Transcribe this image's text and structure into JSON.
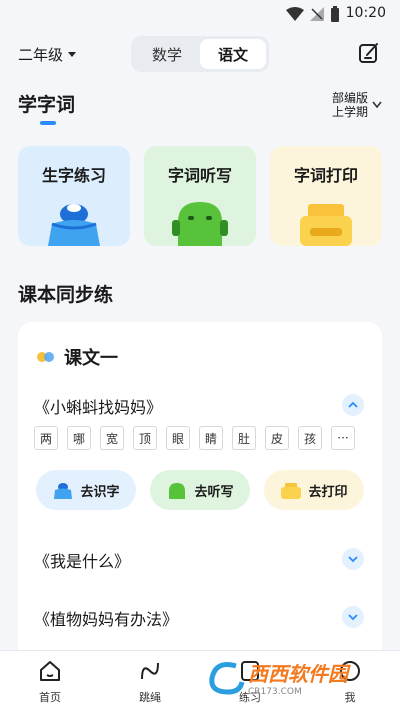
{
  "status_bar": {
    "time": "10:20"
  },
  "header": {
    "grade": "二年级",
    "subjects": [
      "数学",
      "语文"
    ],
    "active_subject": "语文"
  },
  "learn_section": {
    "title": "学字词",
    "edition_line1": "部编版",
    "edition_line2": "上学期",
    "cards": [
      {
        "label": "生字练习",
        "bg": "#dceefd",
        "icon": "hat-icon"
      },
      {
        "label": "字词听写",
        "bg": "#dff4df",
        "icon": "headphone-icon"
      },
      {
        "label": "字词打印",
        "bg": "#fdf4dc",
        "icon": "printer-icon"
      }
    ]
  },
  "sync_section": {
    "title": "课本同步练",
    "lesson_title": "课文一",
    "texts": [
      "《小蝌蚪找妈妈》",
      "《我是什么》",
      "《植物妈妈有办法》"
    ],
    "characters": [
      "两",
      "哪",
      "宽",
      "顶",
      "眼",
      "睛",
      "肚",
      "皮",
      "孩",
      "···"
    ],
    "actions": [
      "去识字",
      "去听写",
      "去打印"
    ]
  },
  "bottom_nav": {
    "items": [
      "首页",
      "跳绳",
      "练习",
      "我"
    ]
  },
  "watermark": {
    "text": "西西软件园",
    "sub": "CR173.COM"
  },
  "colors": {
    "accent": "#2a8cff",
    "page_bg": "#f4f6fa"
  }
}
